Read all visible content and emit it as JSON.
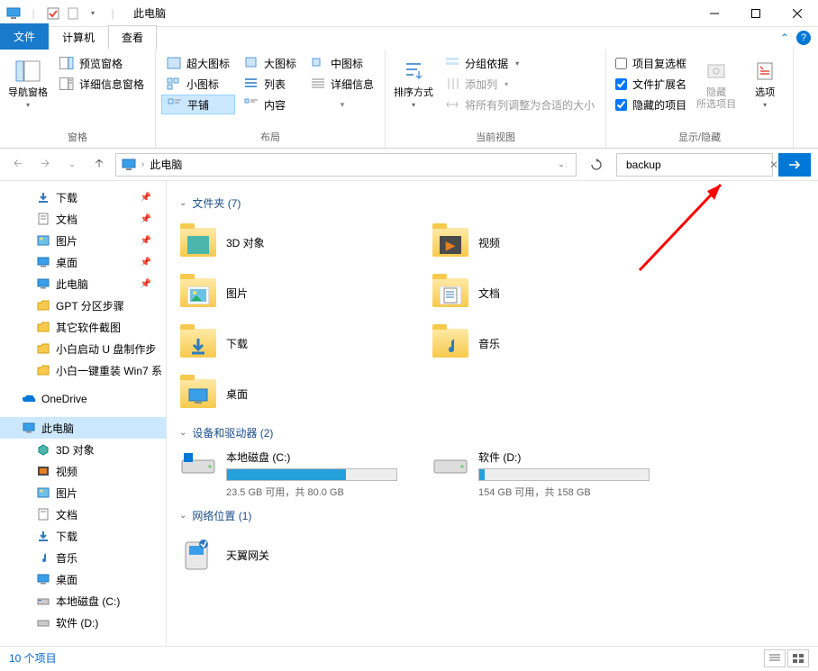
{
  "window": {
    "title": "此电脑"
  },
  "tabs": {
    "file": "文件",
    "computer": "计算机",
    "view": "查看"
  },
  "ribbon": {
    "group_panes": {
      "label": "窗格",
      "nav_pane": "导航窗格",
      "preview": "预览窗格",
      "details": "详细信息窗格"
    },
    "group_layout": {
      "label": "布局",
      "extra_large": "超大图标",
      "large": "大图标",
      "medium": "中图标",
      "small": "小图标",
      "list": "列表",
      "details": "详细信息",
      "tiles": "平铺",
      "content": "内容"
    },
    "group_current": {
      "label": "当前视图",
      "sort": "排序方式",
      "group": "分组依据",
      "add_cols": "添加列",
      "size_cols": "将所有列调整为合适的大小"
    },
    "group_show": {
      "label": "显示/隐藏",
      "checkboxes": "项目复选框",
      "extensions": "文件扩展名",
      "hidden": "隐藏的项目",
      "hide_sel": "隐藏\n所选项目",
      "options": "选项"
    }
  },
  "address": {
    "location": "此电脑"
  },
  "search": {
    "value": "backup"
  },
  "tree": {
    "downloads": "下载",
    "documents": "文档",
    "pictures": "图片",
    "desktop": "桌面",
    "thispc": "此电脑",
    "gpt": "GPT 分区步骤",
    "other_soft": "其它软件截图",
    "xiaobai_u": "小白启动 U 盘制作步",
    "xiaobai_win7": "小白一键重装 Win7 系",
    "onedrive": "OneDrive",
    "thispc2": "此电脑",
    "obj3d": "3D 对象",
    "videos": "视频",
    "pictures2": "图片",
    "documents2": "文档",
    "downloads2": "下载",
    "music": "音乐",
    "desktop2": "桌面",
    "drive_c": "本地磁盘 (C:)",
    "drive_d": "软件 (D:)"
  },
  "sections": {
    "folders": {
      "title": "文件夹 (7)"
    },
    "devices": {
      "title": "设备和驱动器 (2)"
    },
    "network": {
      "title": "网络位置 (1)"
    }
  },
  "folders": {
    "obj3d": "3D 对象",
    "videos": "视频",
    "pictures": "图片",
    "documents": "文档",
    "downloads": "下载",
    "music": "音乐",
    "desktop": "桌面"
  },
  "drives": {
    "c": {
      "label": "本地磁盘 (C:)",
      "sub": "23.5 GB 可用，共 80.0 GB",
      "fill": 70
    },
    "d": {
      "label": "软件 (D:)",
      "sub": "154 GB 可用，共 158 GB",
      "fill": 3
    }
  },
  "network": {
    "gateway": "天翼网关"
  },
  "status": {
    "count": "10 个项目"
  }
}
